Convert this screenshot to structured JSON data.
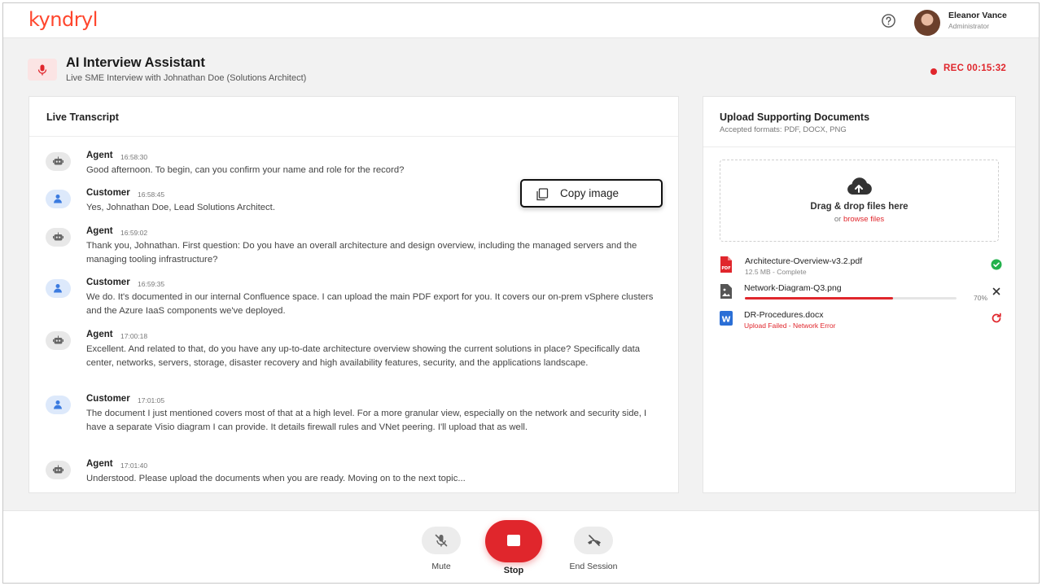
{
  "header": {
    "logo_text": "kyndryl",
    "user_name": "Eleanor Vance",
    "user_role": "Administrator"
  },
  "session": {
    "title": "AI Interview Assistant",
    "subtitle": "Live SME Interview with Johnathan Doe (Solutions Architect)",
    "rec_label": "REC 00:15:32"
  },
  "transcript": {
    "title": "Live Transcript",
    "messages": [
      {
        "speaker": "Agent",
        "time": "16:58:30",
        "text": "Good afternoon. To begin, can you confirm your name and role for the record?"
      },
      {
        "speaker": "Customer",
        "time": "16:58:45",
        "text": "Yes, Johnathan Doe, Lead Solutions Architect."
      },
      {
        "speaker": "Agent",
        "time": "16:59:02",
        "text": "Thank you, Johnathan. First question: Do you have an overall architecture and design overview, including the managed servers and the managing tooling infrastructure?"
      },
      {
        "speaker": "Customer",
        "time": "16:59:35",
        "text": "We do. It's documented in our internal Confluence space. I can upload the main PDF export for you. It covers our on-prem vSphere clusters and the Azure IaaS components we've deployed."
      },
      {
        "speaker": "Agent",
        "time": "17:00:18",
        "text": "Excellent. And related to that, do you have any up-to-date architecture overview showing the current solutions in place? Specifically data center, networks, servers, storage, disaster recovery and high availability features, security, and the applications landscape."
      },
      {
        "speaker": "Customer",
        "time": "17:01:05",
        "text": "The document I just mentioned covers most of that at a high level. For a more granular view, especially on the network and security side, I have a separate Visio diagram I can provide. It details firewall rules and VNet peering. I'll upload that as well."
      },
      {
        "speaker": "Agent",
        "time": "17:01:40",
        "text": "Understood. Please upload the documents when you are ready. Moving on to the next topic..."
      }
    ]
  },
  "upload": {
    "title": "Upload Supporting Documents",
    "formats": "Accepted formats: PDF, DOCX, PNG",
    "drop_title": "Drag & drop files here",
    "drop_or": "or ",
    "drop_link": "browse files",
    "files": [
      {
        "name": "Architecture-Overview-v3.2.pdf",
        "status": "12.5 MB - Complete",
        "type": "pdf",
        "state": "complete"
      },
      {
        "name": "Network-Diagram-Q3.png",
        "progress_label": "70%",
        "progress": 0.7,
        "type": "png",
        "state": "uploading"
      },
      {
        "name": "DR-Procedures.docx",
        "status": "Upload Failed - Network Error",
        "type": "docx",
        "state": "failed"
      }
    ]
  },
  "popup": {
    "label": "Copy image"
  },
  "controls": {
    "mute": "Mute",
    "stop": "Stop",
    "end": "End Session"
  },
  "colors": {
    "brand": "#ff462d",
    "accent_red": "#e0262c",
    "success": "#22b14c"
  },
  "icons": [
    "help-icon",
    "mic-icon",
    "robot-icon",
    "user-icon",
    "cloud-upload-icon",
    "pdf-file-icon",
    "image-file-icon",
    "word-file-icon",
    "check-circle-icon",
    "close-icon",
    "retry-icon",
    "copy-icon",
    "mic-off-icon",
    "stop-icon",
    "end-call-icon"
  ]
}
